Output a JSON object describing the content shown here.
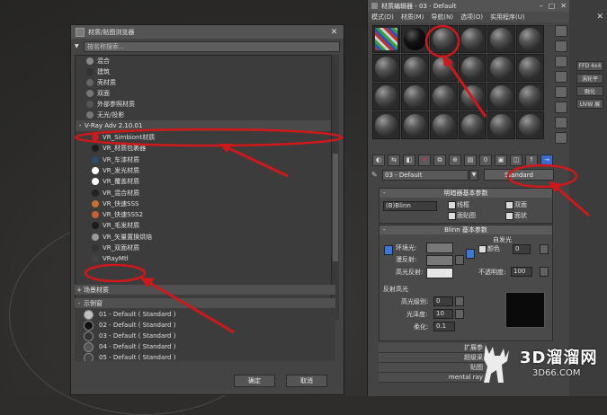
{
  "browser": {
    "title": "材质/贴图浏览器",
    "search_placeholder": "按名称搜索...",
    "items": [
      {
        "label": "混合",
        "color": "#888888"
      },
      {
        "label": "建筑",
        "color": "#333333"
      },
      {
        "label": "壳材质",
        "color": "#666666"
      },
      {
        "label": "双面",
        "color": "#777777"
      },
      {
        "label": "外部参照材质",
        "color": "#555555"
      },
      {
        "label": "无光/投影",
        "color": "#777777"
      }
    ],
    "vray_section": "V-Ray Adv 2.10.01",
    "vray_items": [
      {
        "label": "VR_Simbiont材质",
        "color": "#c02020"
      },
      {
        "label": "VR_材质包裹器",
        "color": "#1e1e1e"
      },
      {
        "label": "VR_车漆材质",
        "color": "#2a4a70"
      },
      {
        "label": "VR_发光材质",
        "color": "#ffffff"
      },
      {
        "label": "VR_覆盖材质",
        "color": "#ffffff"
      },
      {
        "label": "VR_混合材质",
        "color": "#222222"
      },
      {
        "label": "VR_快速SSS",
        "color": "#c87030"
      },
      {
        "label": "VR_快速SSS2",
        "color": "#c86030"
      },
      {
        "label": "VR_毛发材质",
        "color": "#1c1c1c"
      },
      {
        "label": "VR_矢量置换烘焙",
        "color": "#999999"
      },
      {
        "label": "VR_双面材质",
        "color": "#333333"
      },
      {
        "label": "VRayMtl",
        "color": "#444444"
      }
    ],
    "scene_section": "场景材质",
    "sample_section": "示例窗",
    "samples": [
      "01 - Default ( Standard )",
      "02 - Default ( Standard )",
      "03 - Default ( Standard )",
      "04 - Default ( Standard )",
      "05 - Default ( Standard )"
    ],
    "ok_label": "确定",
    "cancel_label": "取消"
  },
  "editor": {
    "title": "材质编辑器 - 03 - Default",
    "menu": [
      "模式(D)",
      "材质(M)",
      "导航(N)",
      "选项(O)",
      "实用程序(U)"
    ],
    "material_name": "03 - Default",
    "type_button": "Standard",
    "shader_rollout": "明暗器基本参数",
    "shader_type": "(B)Blinn",
    "wire": "线框",
    "two_sided": "双面",
    "face_map": "面贴图",
    "faceted": "面状",
    "blinn_rollout": "Blinn 基本参数",
    "self_illum": "自发光",
    "color_label": "颜色",
    "self_illum_value": "0",
    "ambient": "环境光:",
    "diffuse": "漫反射:",
    "specular": "高光反射:",
    "opacity": "不透明度:",
    "opacity_value": "100",
    "spec_highlights": "反射高光",
    "spec_level": "高光级别:",
    "spec_level_value": "0",
    "glossiness": "光泽度:",
    "glossiness_value": "10",
    "soften": "柔化:",
    "soften_value": "0.1",
    "rollouts": [
      "扩展参",
      "超级采",
      "贴图",
      "mental ray"
    ]
  },
  "right_strip": {
    "buttons": [
      "FFD 4x4",
      "涡轮平",
      "融化",
      "UVW 展"
    ]
  },
  "watermark": {
    "main": "3D溜溜网",
    "sub": "3D66.COM"
  }
}
